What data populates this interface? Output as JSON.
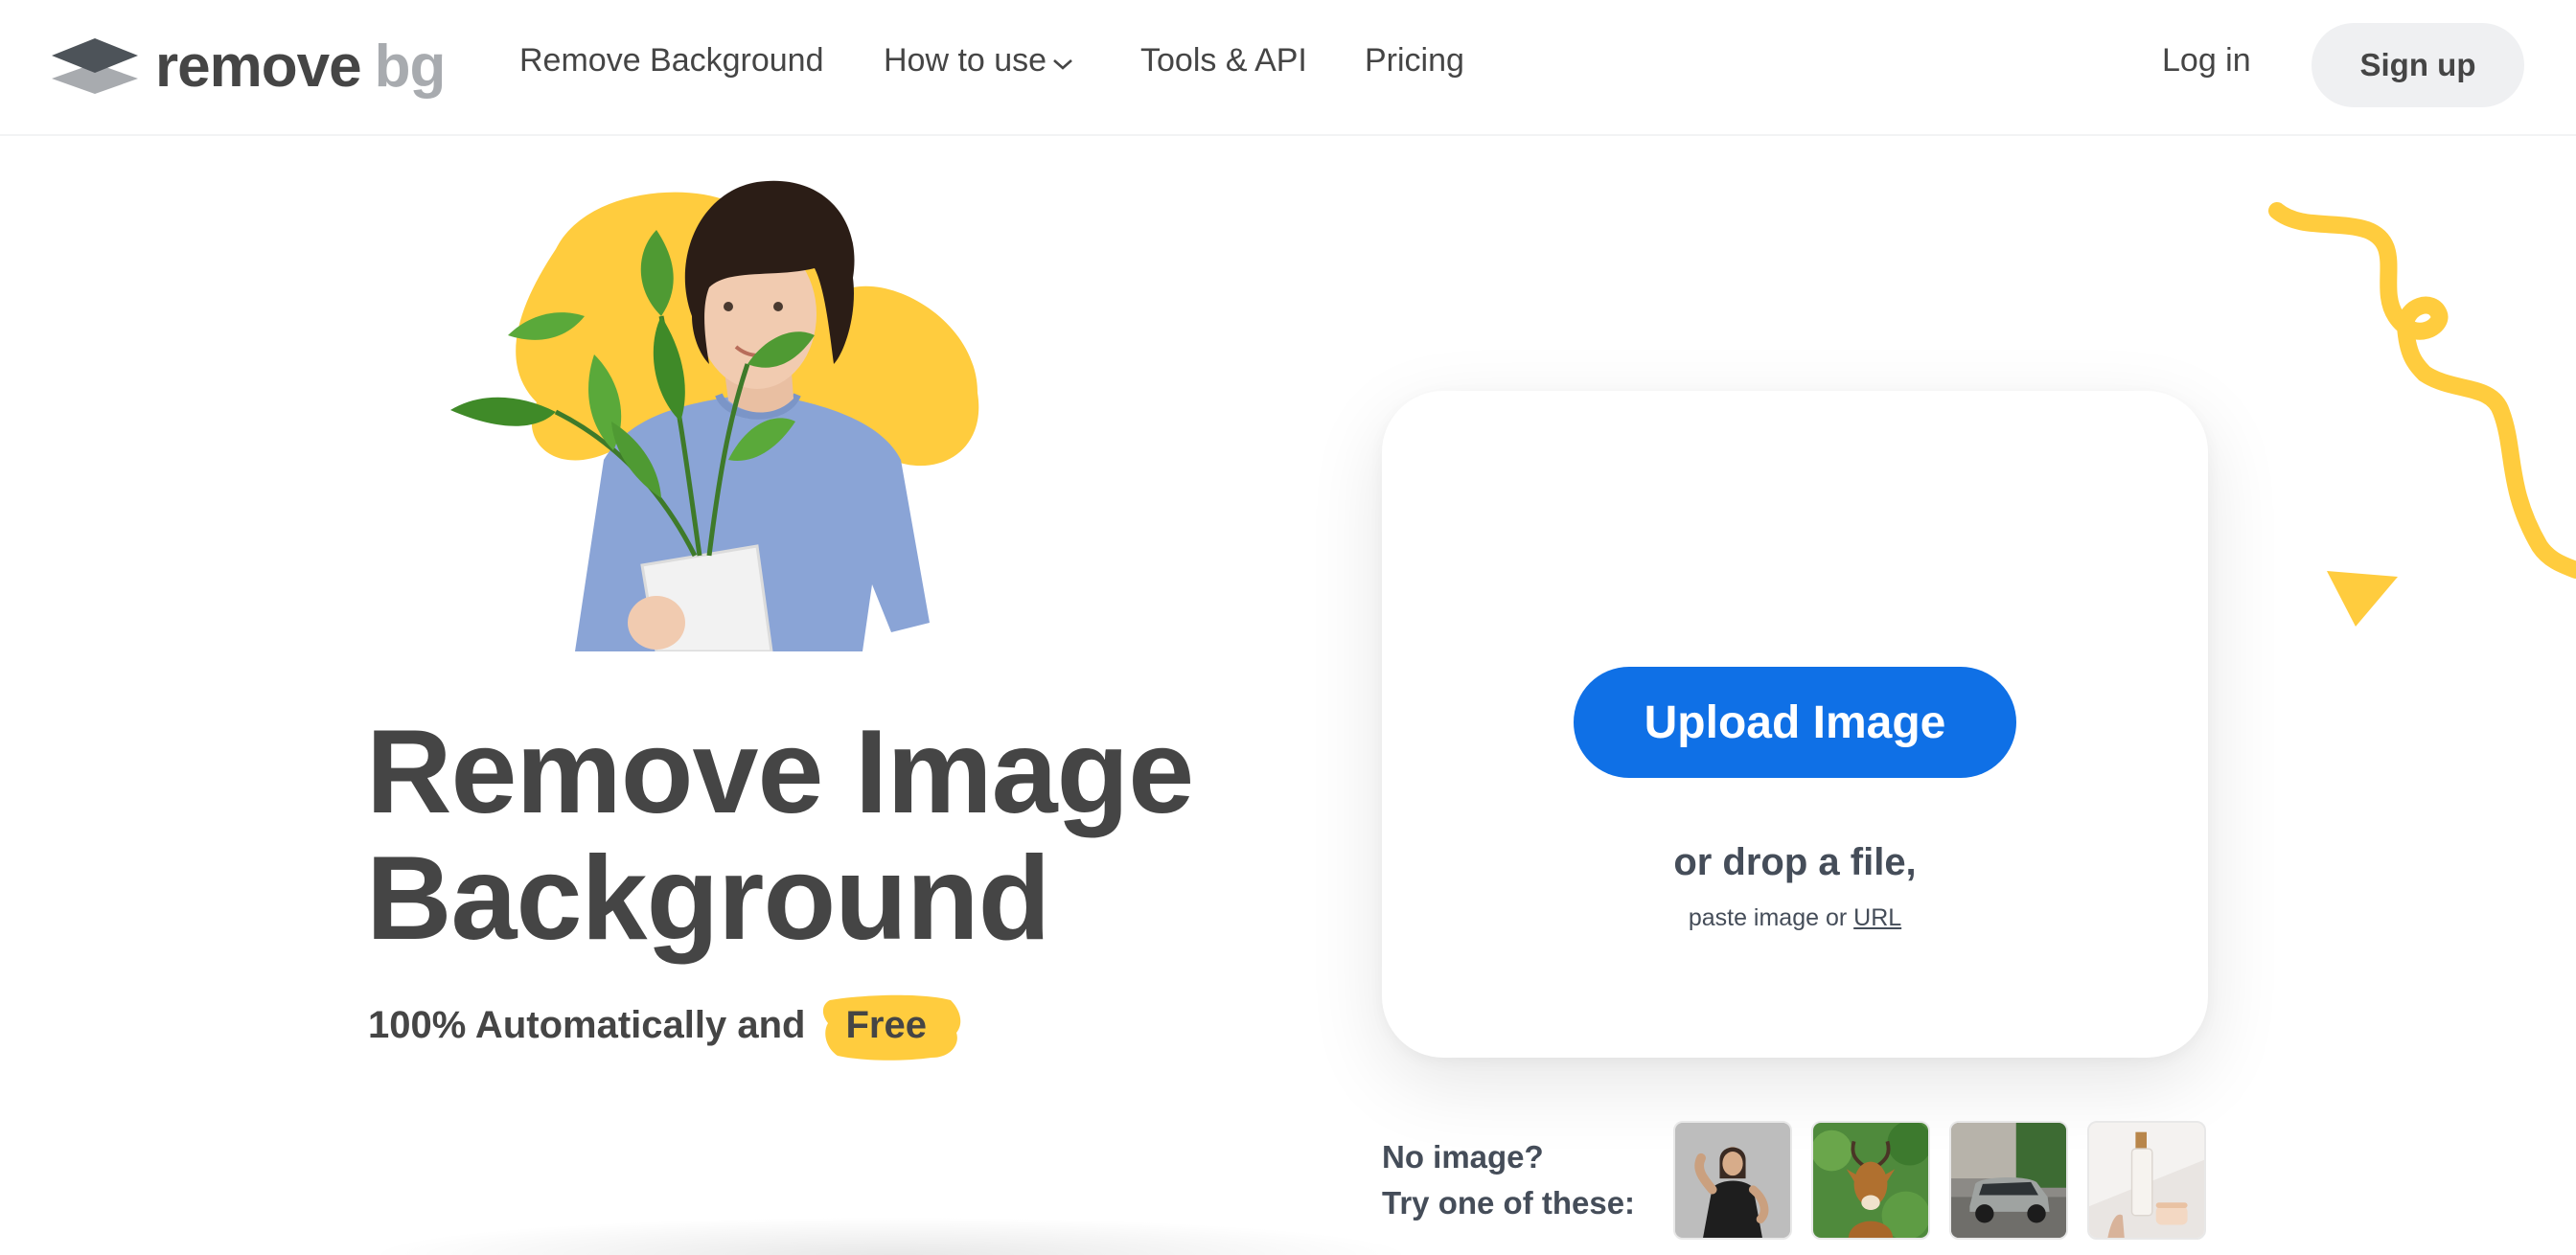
{
  "header": {
    "logo": {
      "word1": "remove",
      "word2": "bg"
    },
    "nav": [
      {
        "label": "Remove Background",
        "name": "nav-remove-background"
      },
      {
        "label": "How to use",
        "name": "nav-how-to-use",
        "dropdown": true
      },
      {
        "label": "Tools & API",
        "name": "nav-tools-api"
      },
      {
        "label": "Pricing",
        "name": "nav-pricing"
      }
    ],
    "login_label": "Log in",
    "signup_label": "Sign up"
  },
  "hero": {
    "title_line1": "Remove Image",
    "title_line2": "Background",
    "subtitle_prefix": "100% Automatically and",
    "subtitle_highlight": "Free"
  },
  "upload": {
    "button_label": "Upload Image",
    "drop_text": "or drop a file,",
    "paste_text": "paste image or",
    "url_link": "URL"
  },
  "samples": {
    "line1": "No image?",
    "line2": "Try one of these:",
    "items": [
      {
        "name": "sample-woman-thumbnail",
        "icon": "woman-flexing"
      },
      {
        "name": "sample-deer-thumbnail",
        "icon": "antelope"
      },
      {
        "name": "sample-car-thumbnail",
        "icon": "suv-car"
      },
      {
        "name": "sample-cosmetics-thumbnail",
        "icon": "cosmetic-bottle"
      }
    ]
  },
  "colors": {
    "accent_blue": "#0f70e6",
    "accent_yellow": "#ffcc3e",
    "text_dark": "#454545",
    "logo_grey": "#a8abaf",
    "signup_bg": "#eff0f2"
  }
}
